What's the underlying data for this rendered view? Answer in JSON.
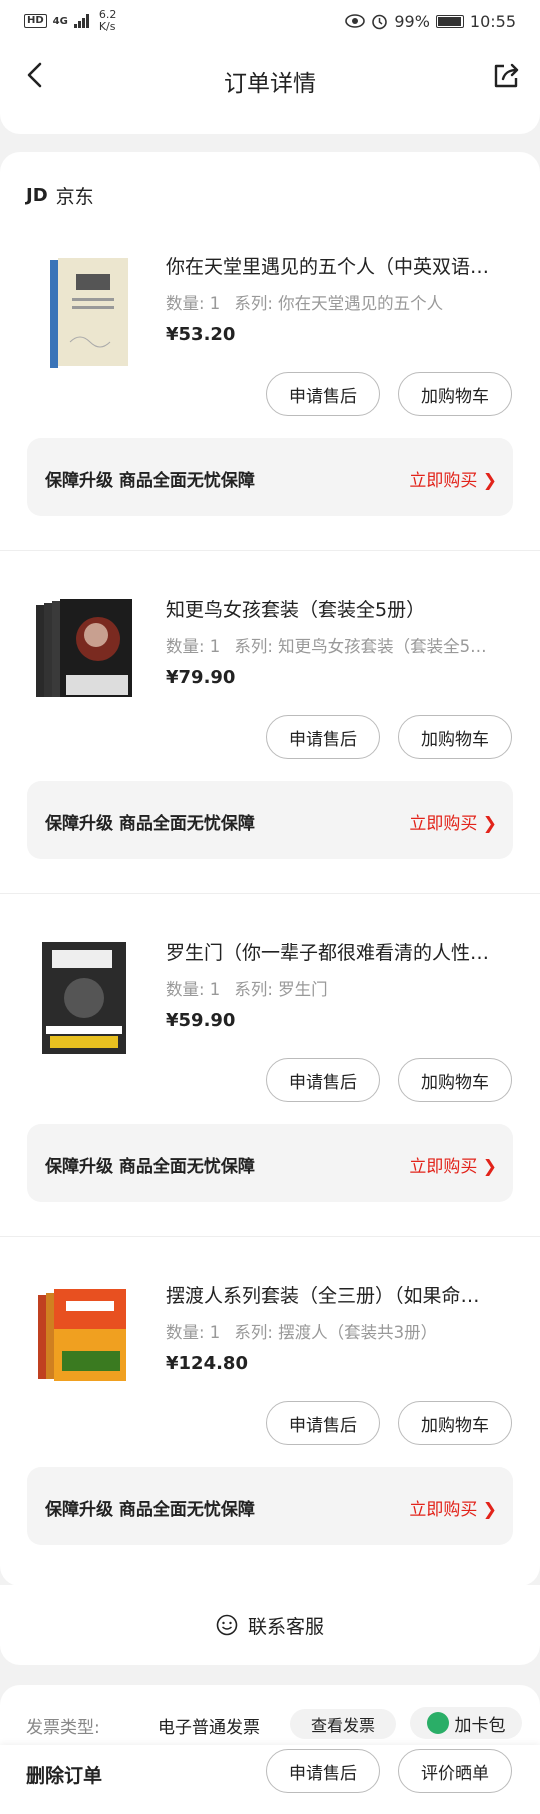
{
  "status_bar": {
    "hd": "HD",
    "network": "4G",
    "speed": "6.2",
    "speed_unit": "K/s",
    "battery": "99%",
    "time": "10:55"
  },
  "header": {
    "title": "订单详情"
  },
  "store": {
    "logo": "JD",
    "name": "京东"
  },
  "items": [
    {
      "name": "你在天堂里遇见的五个人（中英双语…",
      "qty": "数量: 1",
      "series": "系列: 你在天堂遇见的五个人",
      "price": "¥53.20",
      "btn_after_sale": "申请售后",
      "btn_cart": "加购物车",
      "guard_text": "保障升级  商品全面无忧保障",
      "guard_buy": "立即购买 ❯"
    },
    {
      "name": "知更鸟女孩套装（套装全5册）",
      "qty": "数量: 1",
      "series": "系列: 知更鸟女孩套装（套装全5…",
      "price": "¥79.90",
      "btn_after_sale": "申请售后",
      "btn_cart": "加购物车",
      "guard_text": "保障升级  商品全面无忧保障",
      "guard_buy": "立即购买 ❯"
    },
    {
      "name": "罗生门（你一辈子都很难看清的人性…",
      "qty": "数量: 1",
      "series": "系列: 罗生门",
      "price": "¥59.90",
      "btn_after_sale": "申请售后",
      "btn_cart": "加购物车",
      "guard_text": "保障升级  商品全面无忧保障",
      "guard_buy": "立即购买 ❯"
    },
    {
      "name": "摆渡人系列套装（全三册）（如果命…",
      "qty": "数量: 1",
      "series": "系列: 摆渡人（套装共3册）",
      "price": "¥124.80",
      "btn_after_sale": "申请售后",
      "btn_cart": "加购物车",
      "guard_text": "保障升级  商品全面无忧保障",
      "guard_buy": "立即购买 ❯"
    }
  ],
  "service": {
    "label": "联系客服"
  },
  "invoice": {
    "label": "发票类型:",
    "value": "电子普通发票",
    "view_label": "查看发票",
    "card_label": "加卡包"
  },
  "bottom_bar": {
    "delete_label": "删除订单",
    "after_sale_label": "申请售后",
    "review_label": "评价晒单"
  },
  "colors": {
    "accent": "#e2231a",
    "wechat": "#2aae67"
  }
}
